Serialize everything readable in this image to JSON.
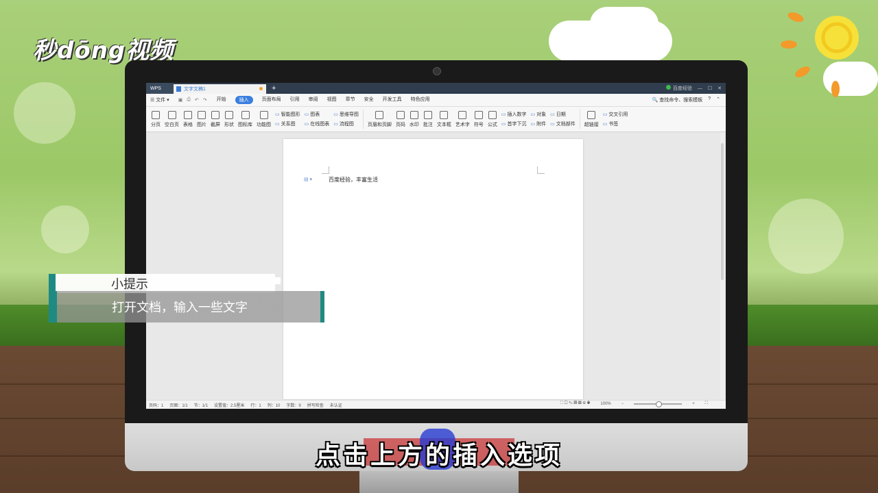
{
  "brand": {
    "logo_text": "秒dōng视频"
  },
  "app": {
    "wps_tab": "WPS",
    "doc_tab": "文字文稿1",
    "new_tab_symbol": "+",
    "title_right": {
      "account_text": "百度经验",
      "minimize": "—",
      "maximize": "☐",
      "close": "✕"
    }
  },
  "menubar": {
    "file": "☰ 文件 ▾",
    "tabs": [
      "开始",
      "插入",
      "页面布局",
      "引用",
      "审阅",
      "视图",
      "章节",
      "安全",
      "开发工具",
      "特色应用"
    ],
    "active_tab": "插入",
    "search": "🔍 查找命令、搜索模板"
  },
  "ribbon": {
    "buttons1": [
      "分页",
      "空白页",
      "表格",
      "图片",
      "截屏",
      "形状",
      "图标库",
      "功能图"
    ],
    "stack1": [
      "智能图形",
      "关系图"
    ],
    "stack2": [
      "图表",
      "在线图表"
    ],
    "stack3": [
      "思维导图",
      "流程图"
    ],
    "buttons2": [
      "页眉和页脚",
      "页码",
      "水印",
      "批注",
      "文本框",
      "艺术字",
      "符号",
      "公式"
    ],
    "stack4": [
      "插入数字",
      "首字下沉"
    ],
    "stack5": [
      "对象",
      "附件"
    ],
    "stack6": [
      "日期",
      "文档部件"
    ],
    "buttons3": [
      "超链接"
    ],
    "stack7": [
      "交叉引用",
      "书签"
    ]
  },
  "document": {
    "text": "百度经验，丰富生活"
  },
  "statusbar": {
    "items": [
      "页码：1",
      "页面：1/1",
      "节：1/1",
      "设置值：2.5厘米",
      "行：1",
      "列：10",
      "字数：9",
      "拼写检查",
      "未认证"
    ],
    "zoom": "100%",
    "zoom_level": 0.5
  },
  "overlay": {
    "tip_title": "小提示",
    "tip_body": "打开文档，输入一些文字",
    "subtitle": "点击上方的插入选项"
  },
  "colors": {
    "accent": "#1f8a83",
    "active_tab": "#3a7fde",
    "titlebar": "#2f3d4e"
  }
}
